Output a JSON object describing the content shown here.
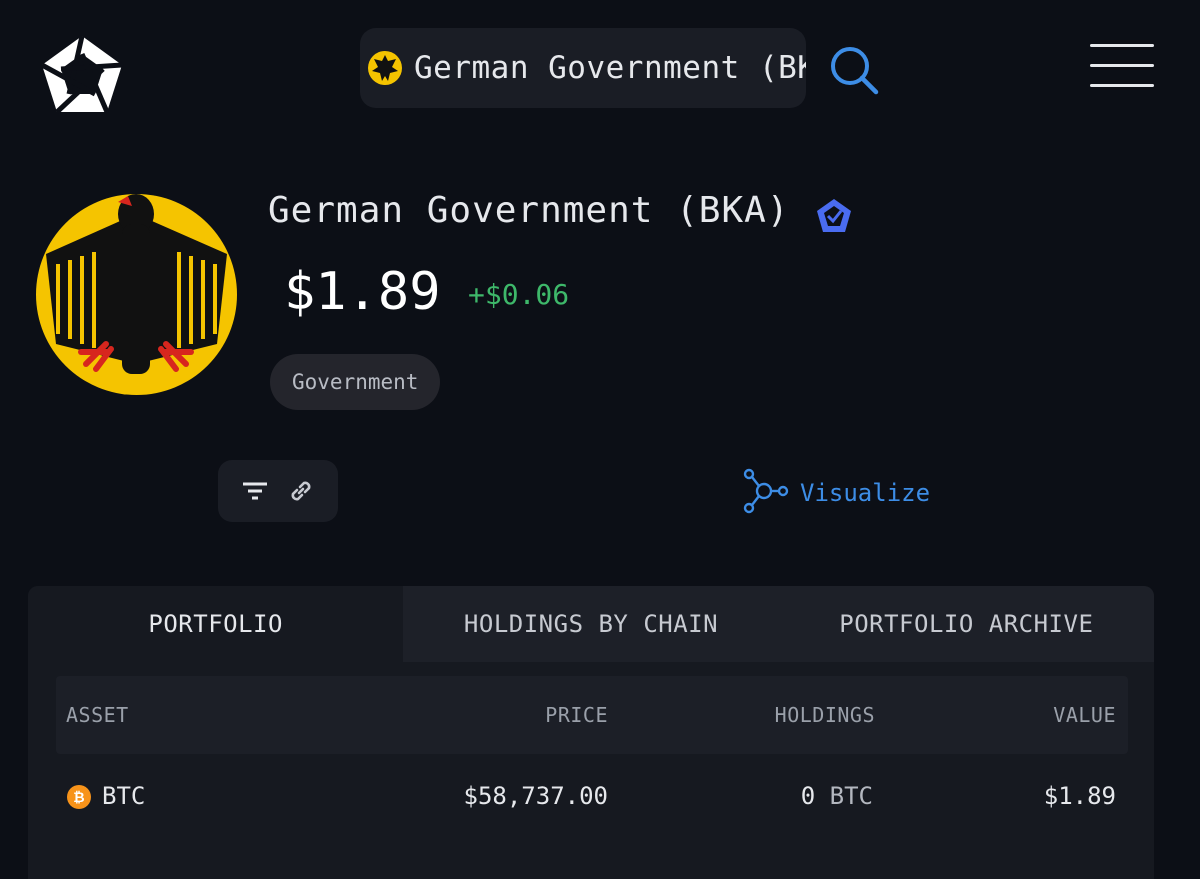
{
  "header": {
    "search_query": "German Government (BKA)"
  },
  "entity": {
    "name": "German Government (BKA)",
    "total_value": "$1.89",
    "change": "+$0.06",
    "tag": "Government"
  },
  "actions": {
    "visualize_label": "Visualize"
  },
  "tabs": [
    {
      "label": "PORTFOLIO",
      "active": true
    },
    {
      "label": "HOLDINGS BY CHAIN",
      "active": false
    },
    {
      "label": "PORTFOLIO ARCHIVE",
      "active": false
    }
  ],
  "table": {
    "columns": {
      "asset": "ASSET",
      "price": "PRICE",
      "holdings": "HOLDINGS",
      "value": "VALUE"
    },
    "rows": [
      {
        "asset": "BTC",
        "price": "$58,737.00",
        "holdings_amount": "0",
        "holdings_unit": "BTC",
        "value": "$1.89"
      }
    ]
  },
  "colors": {
    "background": "#0c0f16",
    "positive": "#3eb86a",
    "accent_blue": "#3d8de6",
    "btc_orange": "#f7931a"
  }
}
